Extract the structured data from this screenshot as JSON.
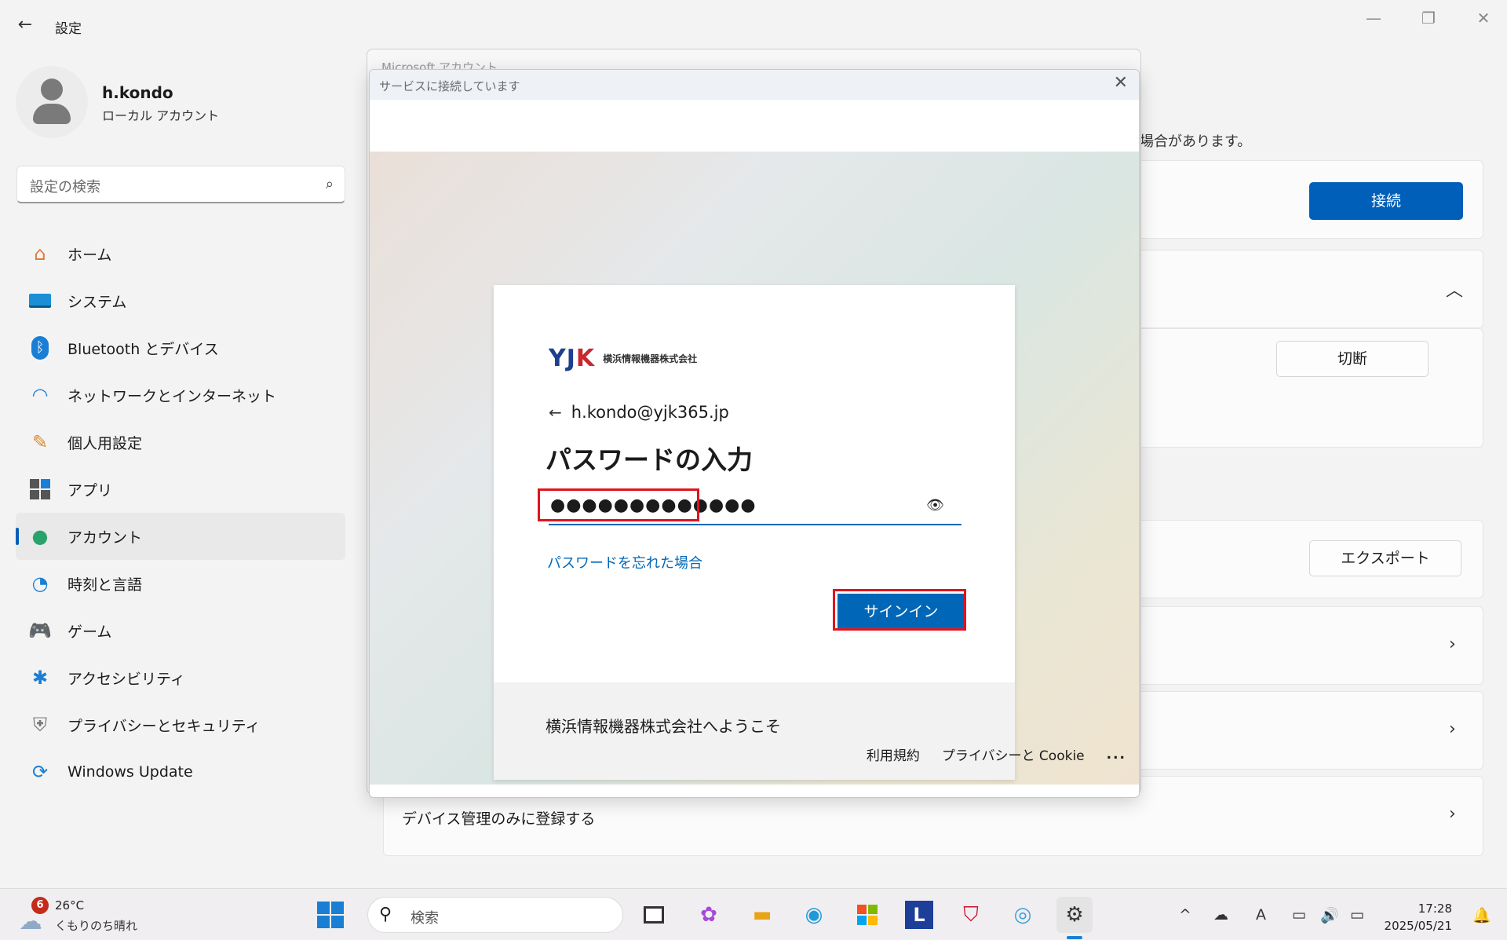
{
  "window": {
    "title": "設定",
    "controls": [
      "—",
      "❐",
      "✕"
    ]
  },
  "profile": {
    "name": "h.kondo",
    "account_type": "ローカル アカウント"
  },
  "search": {
    "placeholder": "設定の検索"
  },
  "nav": [
    {
      "label": "ホーム",
      "icon": "home-icon",
      "active": false
    },
    {
      "label": "システム",
      "icon": "system-icon",
      "active": false
    },
    {
      "label": "Bluetooth とデバイス",
      "icon": "bluetooth-icon",
      "active": false
    },
    {
      "label": "ネットワークとインターネット",
      "icon": "wifi-icon",
      "active": false
    },
    {
      "label": "個人用設定",
      "icon": "brush-icon",
      "active": false
    },
    {
      "label": "アプリ",
      "icon": "apps-icon",
      "active": false
    },
    {
      "label": "アカウント",
      "icon": "account-icon",
      "active": true
    },
    {
      "label": "時刻と言語",
      "icon": "clock-globe-icon",
      "active": false
    },
    {
      "label": "ゲーム",
      "icon": "gamepad-icon",
      "active": false
    },
    {
      "label": "アクセシビリティ",
      "icon": "accessibility-icon",
      "active": false
    },
    {
      "label": "プライバシーとセキュリティ",
      "icon": "shield-icon",
      "active": false
    },
    {
      "label": "Windows Update",
      "icon": "update-icon",
      "active": false
    }
  ],
  "right_panel": {
    "partial_text": "場合があります。",
    "connect_label": "接続",
    "disconnect_label": "切断",
    "export_label": "エクスポート",
    "device_mgmt_label": "デバイス管理のみに登録する"
  },
  "back_dialog": {
    "title": "Microsoft アカウント"
  },
  "dialog": {
    "title": "サービスに接続しています",
    "company_name": "横浜情報機器株式会社",
    "email": "h.kondo@yjk365.jp",
    "heading": "パスワードの入力",
    "password_masked": "●●●●●●●●●●●●●",
    "forgot_link": "パスワードを忘れた場合",
    "signin_label": "サインイン",
    "welcome": "横浜情報機器株式会社へようこそ",
    "terms_link": "利用規約",
    "privacy_link": "プライバシーと Cookie",
    "more_label": "..."
  },
  "taskbar": {
    "weather_badge": "6",
    "temperature": "26°C",
    "weather_desc": "くもりのち晴れ",
    "search_placeholder": "検索",
    "time": "17:28",
    "date": "2025/05/21"
  },
  "colors": {
    "accent": "#005fb8",
    "highlight_box": "#e0141e",
    "ms_blue": "#0067b8"
  }
}
